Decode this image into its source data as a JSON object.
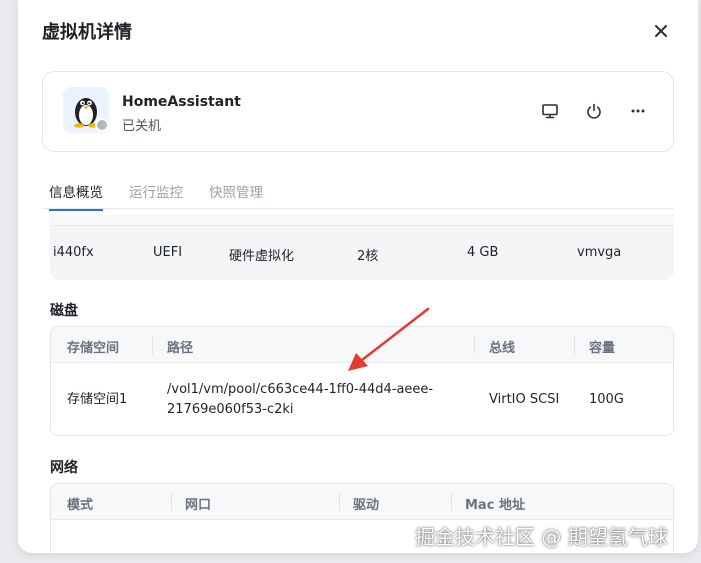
{
  "dialog": {
    "title": "虚拟机详情"
  },
  "vm": {
    "name": "HomeAssistant",
    "state": "已关机"
  },
  "tabs": [
    {
      "label": "信息概览",
      "active": true
    },
    {
      "label": "运行监控",
      "active": false
    },
    {
      "label": "快照管理",
      "active": false
    }
  ],
  "specs": [
    "i440fx",
    "UEFI",
    "硬件虚拟化",
    "2核",
    "4 GB",
    "vmvga"
  ],
  "disk": {
    "title": "磁盘",
    "headers": [
      "存储空间",
      "路径",
      "总线",
      "容量"
    ],
    "rows": [
      {
        "space": "存储空间1",
        "path_line1": "/vol1/vm/pool/c663ce44-1ff0-44d4-aeee-",
        "path_line2": "21769e060f53-c2ki",
        "bus": "VirtIO SCSI",
        "size": "100G"
      }
    ]
  },
  "network": {
    "title": "网络",
    "headers": [
      "模式",
      "网口",
      "驱动",
      "Mac 地址"
    ]
  },
  "watermark": "掘金技术社区 @ 期望氢气球",
  "colors": {
    "accent": "#2b6fe7",
    "arrow": "#e53a2f",
    "status_off": "#b5b9bf"
  },
  "icons": {
    "close": "close-icon",
    "monitor": "monitor-icon",
    "power": "power-icon",
    "more": "more-icon",
    "os": "linux-penguin-icon"
  }
}
